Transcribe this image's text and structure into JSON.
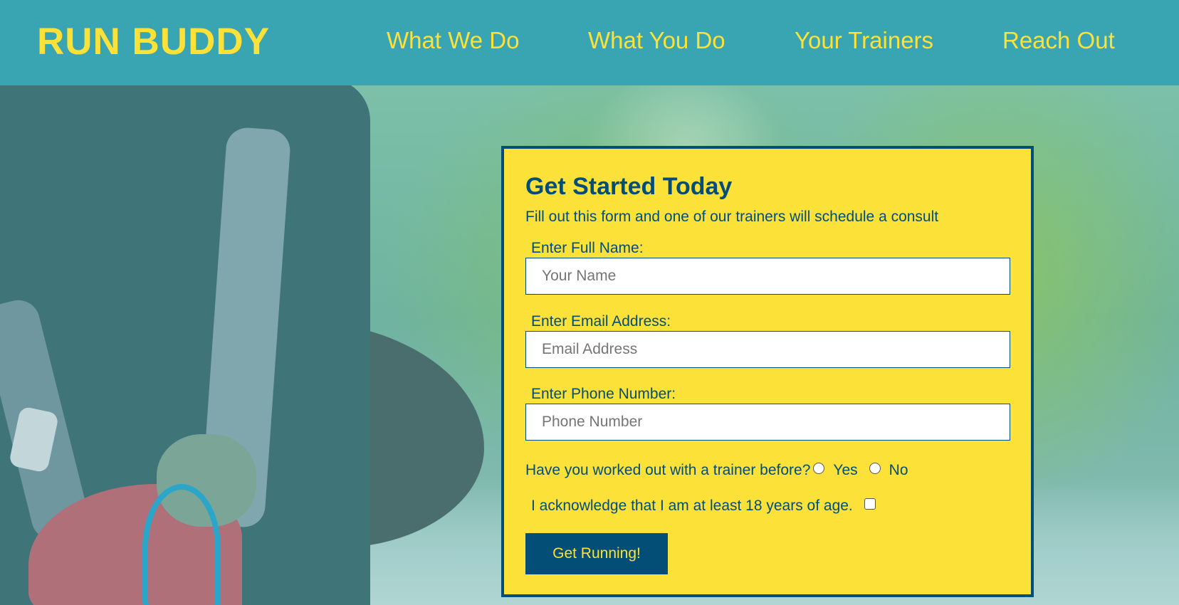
{
  "header": {
    "logo": "RUN BUDDY",
    "nav": [
      {
        "label": "What We Do"
      },
      {
        "label": "What You Do"
      },
      {
        "label": "Your Trainers"
      },
      {
        "label": "Reach Out"
      }
    ]
  },
  "form": {
    "title": "Get Started Today",
    "subtitle": "Fill out this form and one of our trainers will schedule a consult",
    "name": {
      "label": "Enter Full Name:",
      "placeholder": "Your Name",
      "value": ""
    },
    "email": {
      "label": "Enter Email Address:",
      "placeholder": "Email Address",
      "value": ""
    },
    "phone": {
      "label": "Enter Phone Number:",
      "placeholder": "Phone Number",
      "value": ""
    },
    "trainer_question": {
      "label": "Have you worked out with a trainer before?",
      "options": [
        "Yes",
        "No"
      ],
      "selected": null
    },
    "age_ack": {
      "label": "I acknowledge that I am at least 18 years of age.",
      "checked": false
    },
    "submit_label": "Get Running!"
  },
  "colors": {
    "header_bg": "#39a5b2",
    "accent_yellow": "#fce138",
    "navy": "#024e76"
  }
}
